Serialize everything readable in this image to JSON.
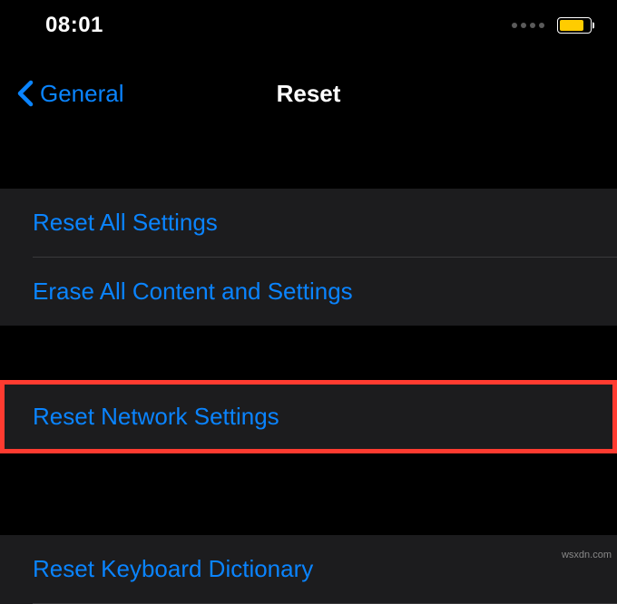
{
  "status": {
    "time": "08:01"
  },
  "nav": {
    "back_label": "General",
    "title": "Reset"
  },
  "rows": {
    "reset_all": "Reset All Settings",
    "erase_all": "Erase All Content and Settings",
    "reset_network": "Reset Network Settings",
    "reset_keyboard": "Reset Keyboard Dictionary"
  },
  "watermark": "wsxdn.com"
}
